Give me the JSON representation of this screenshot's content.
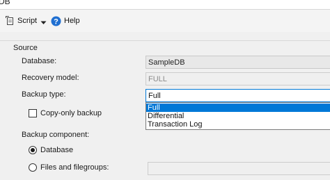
{
  "window": {
    "title": "DB"
  },
  "toolbar": {
    "script_label": "Script",
    "help_label": "Help"
  },
  "source": {
    "section_title": "Source",
    "database_label": "Database:",
    "database_value": "SampleDB",
    "recovery_model_label": "Recovery model:",
    "recovery_model_value": "FULL",
    "backup_type_label": "Backup type:",
    "backup_type_value": "Full",
    "backup_type_options": [
      "Full",
      "Differential",
      "Transaction Log"
    ],
    "backup_type_highlighted": "Full",
    "copy_only_label": "Copy-only backup",
    "copy_only_checked": false,
    "backup_component_label": "Backup component:",
    "component_database_label": "Database",
    "component_files_label": "Files and filegroups:",
    "component_selected": "Database"
  },
  "colors": {
    "accent": "#0078d7",
    "help_icon": "#1f6fd1",
    "panel_bg": "#f0f0f0"
  },
  "icons": {
    "script": "script-icon",
    "dropdown": "chevron-down-icon",
    "help": "help-icon"
  }
}
